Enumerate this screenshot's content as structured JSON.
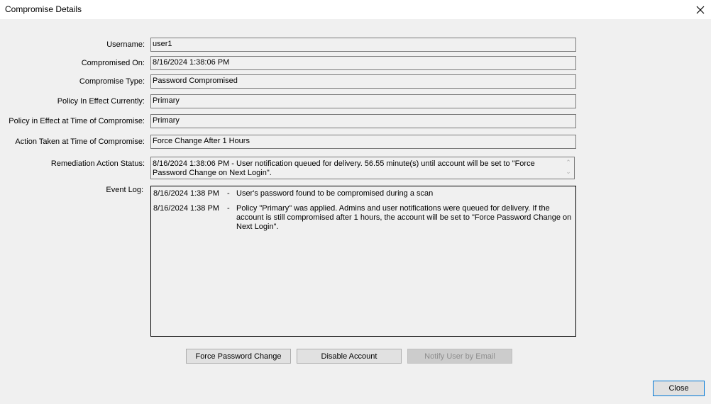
{
  "window": {
    "title": "Compromise Details"
  },
  "fields": [
    {
      "label": "Username:",
      "value": "user1"
    },
    {
      "label": "Compromised On:",
      "value": "8/16/2024 1:38:06 PM"
    },
    {
      "label": "Compromise Type:",
      "value": "Password Compromised"
    },
    {
      "label": "Policy In Effect Currently:",
      "value": "Primary"
    },
    {
      "label": "Policy in Effect at Time of Compromise:",
      "value": "Primary"
    },
    {
      "label": "Action Taken at Time of Compromise:",
      "value": "Force Change After 1 Hours"
    }
  ],
  "remediation": {
    "label": "Remediation Action Status:",
    "value": "8/16/2024 1:38:06 PM - User notification queued for delivery. 56.55 minute(s) until account will be set to \"Force Password Change on Next Login\"."
  },
  "event_log": {
    "label": "Event Log:",
    "entries": [
      {
        "date": "8/16/2024 1:38 PM",
        "sep": "-",
        "message": "User's password found to be compromised during a scan"
      },
      {
        "date": "8/16/2024 1:38 PM",
        "sep": "-",
        "message": "Policy \"Primary\" was applied.  Admins and user notifications were queued for delivery.  If the account is still compromised after 1 hours, the account will be set to \"Force Password Change on Next Login\"."
      }
    ]
  },
  "buttons": {
    "force_password_change": "Force Password Change",
    "disable_account": "Disable Account",
    "notify_user": "Notify User by Email",
    "close": "Close"
  }
}
